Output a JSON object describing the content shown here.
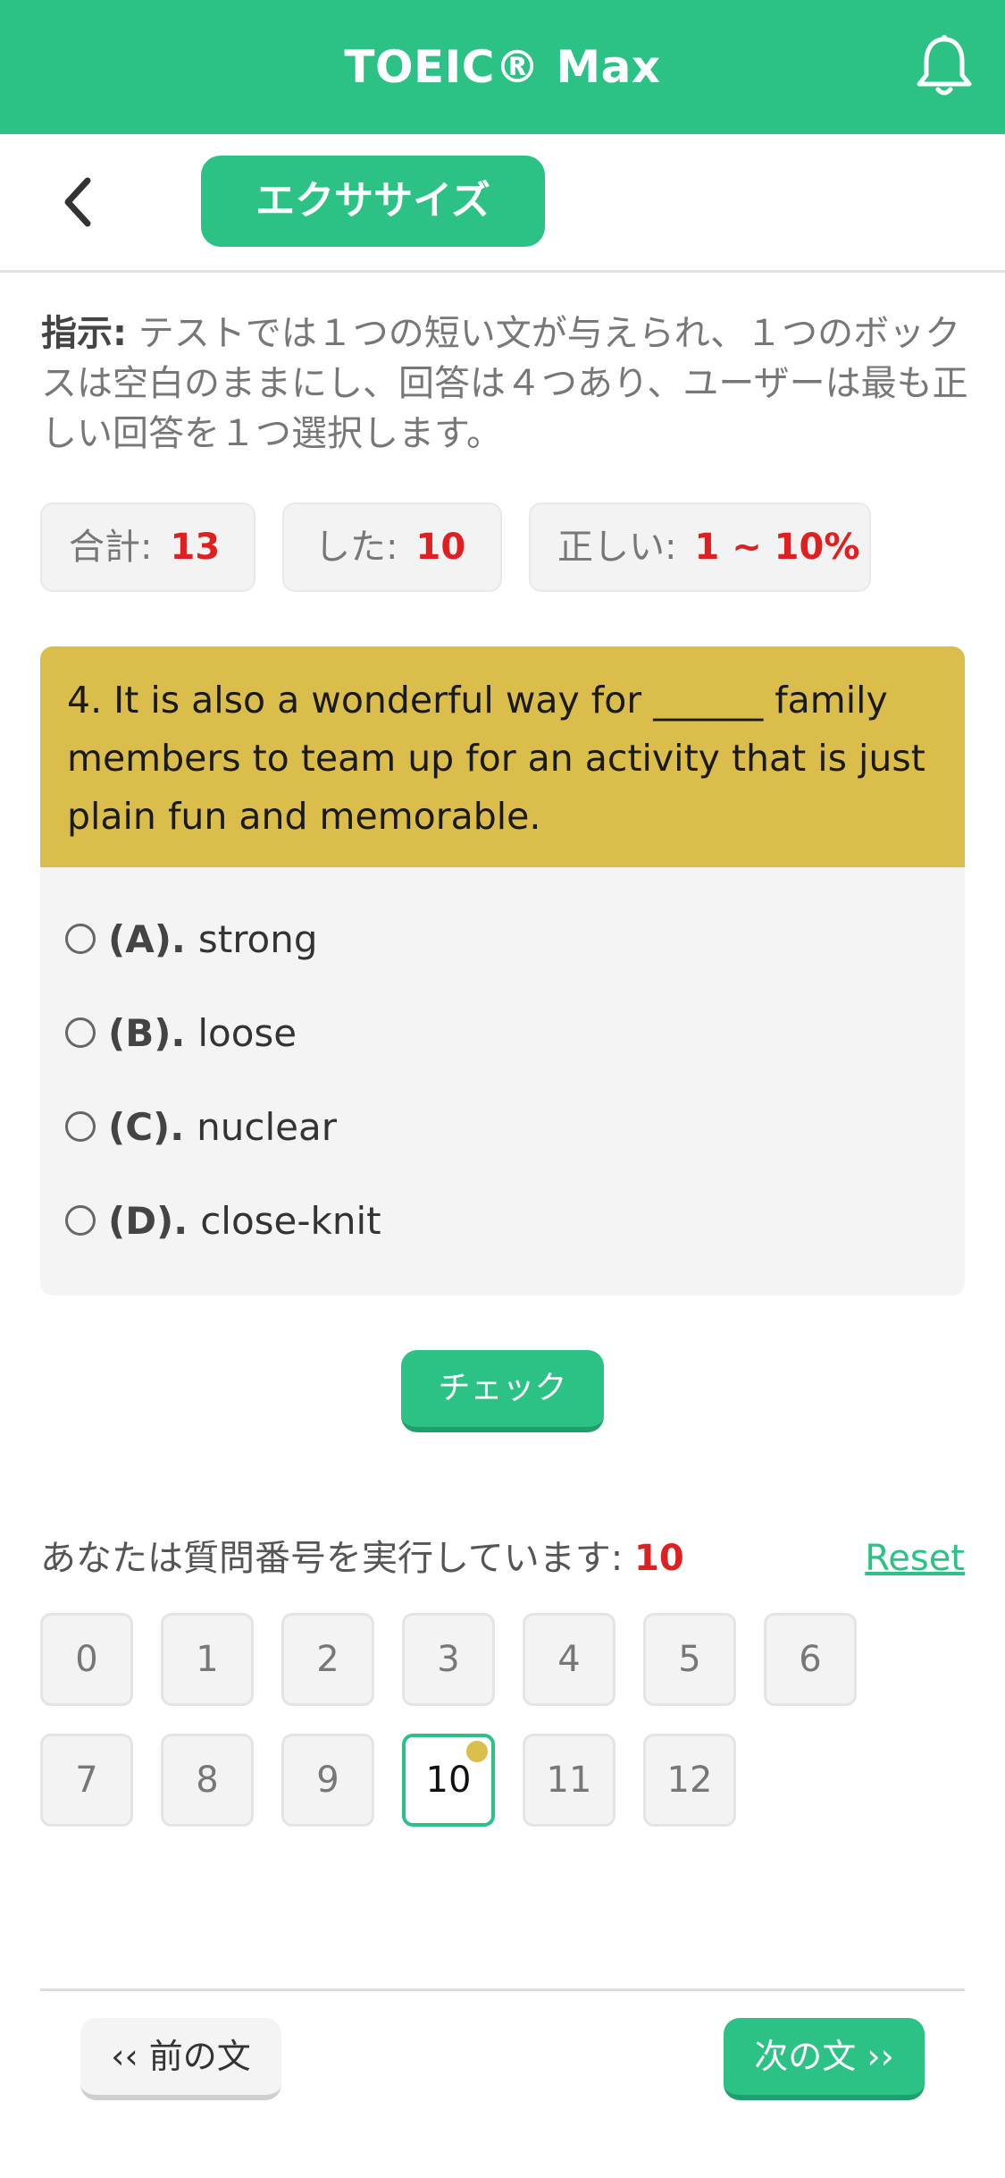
{
  "app": {
    "title": "TOEIC® Max"
  },
  "header": {
    "tab_label": "エクササイズ"
  },
  "instruction": {
    "label": "指示:",
    "text": " テストでは１つの短い文が与えられ、１つのボックスは空白のままにし、回答は４つあり、ユーザーは最も正しい回答を１つ選択します。"
  },
  "stats": [
    {
      "label": "合計:",
      "value": "13"
    },
    {
      "label": "した:",
      "value": "10"
    },
    {
      "label": "正しい:",
      "value": "1 ~ 10%"
    }
  ],
  "question": {
    "text": "4. It is also a wonderful way for ______ family members to team up for an activity that is just plain fun and memorable.",
    "options": [
      {
        "label": "(A).",
        "text": "strong"
      },
      {
        "label": "(B).",
        "text": "loose"
      },
      {
        "label": "(C).",
        "text": "nuclear"
      },
      {
        "label": "(D).",
        "text": "close-knit"
      }
    ]
  },
  "check_button": "チェック",
  "progress": {
    "text": "あなたは質問番号を実行しています: ",
    "current": "10",
    "reset_label": "Reset"
  },
  "question_numbers": [
    "0",
    "1",
    "2",
    "3",
    "4",
    "5",
    "6",
    "7",
    "8",
    "9",
    "10",
    "11",
    "12"
  ],
  "nav": {
    "prev_label": "‹‹ 前の文",
    "next_label": "次の文 ››"
  },
  "colors": {
    "accent": "#2cc286",
    "question_header": "#dbbd4c",
    "highlight": "#e02020"
  },
  "icons": {
    "bell": "bell-icon",
    "back": "chevron-left-icon"
  }
}
